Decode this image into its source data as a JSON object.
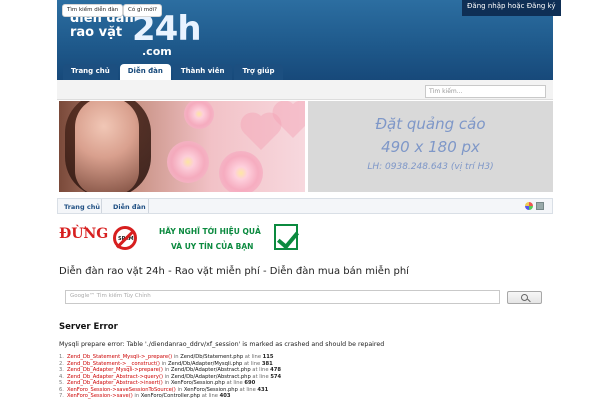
{
  "header": {
    "logo_lines": [
      "diễn đàn",
      "rao vặt"
    ],
    "logo_big": "24h",
    "logo_com": ".com",
    "login_link": "Đăng nhập hoặc Đăng ký"
  },
  "tabs": [
    "Trang chủ",
    "Diễn đàn",
    "Thành viên",
    "Trợ giúp"
  ],
  "subnav": [
    "Tìm kiếm diễn đàn",
    "Có gì mới?"
  ],
  "search": {
    "placeholder": "Tìm kiếm..."
  },
  "ad": {
    "line1": "Đặt quảng cáo",
    "line2": "490 x 180 px",
    "line3": "LH: 0938.248.643   (vị trí H3)"
  },
  "breadcrumb": [
    "Trang chủ",
    "Diễn đàn"
  ],
  "promo": {
    "text1": "ĐỪNG",
    "spam": "SPAM",
    "text2": "HÃY NGHĨ TỚI HIỆU QUẢ",
    "text3": "VÀ UY TÍN CỦA BẠN"
  },
  "page_title": "Diễn đàn rao vặt 24h - Rao vặt miễn phí - Diễn đàn mua bán miễn phí",
  "google_search": {
    "placeholder": "Google™ Tìm kiếm Tùy Chỉnh"
  },
  "error": {
    "heading": "Server Error",
    "message": "Mysqli prepare error: Table './diendanrao_ddrv/xf_session' is marked as crashed and should be repaired",
    "trace": [
      {
        "n": "1.",
        "fn": "Zend_Db_Statement_Mysqli->_prepare()",
        "file": "Zend/Db/Statement.php",
        "line": "115"
      },
      {
        "n": "2.",
        "fn": "Zend_Db_Statement->__construct()",
        "file": "Zend/Db/Adapter/Mysqli.php",
        "line": "381"
      },
      {
        "n": "3.",
        "fn": "Zend_Db_Adapter_Mysqli->prepare()",
        "file": "Zend/Db/Adapter/Abstract.php",
        "line": "478"
      },
      {
        "n": "4.",
        "fn": "Zend_Db_Adapter_Abstract->query()",
        "file": "Zend/Db/Adapter/Abstract.php",
        "line": "574"
      },
      {
        "n": "5.",
        "fn": "Zend_Db_Adapter_Abstract->insert()",
        "file": "XenForo/Session.php",
        "line": "690"
      },
      {
        "n": "6.",
        "fn": "XenForo_Session->saveSessionToSource()",
        "file": "XenForo/Session.php",
        "line": "431"
      },
      {
        "n": "7.",
        "fn": "XenForo_Session->save()",
        "file": "XenForo/Controller.php",
        "line": "403"
      }
    ]
  }
}
